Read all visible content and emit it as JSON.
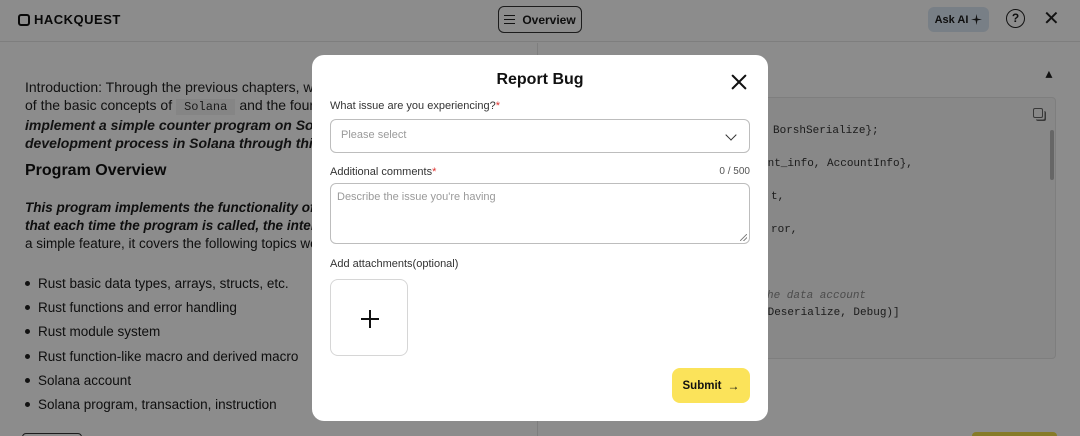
{
  "header": {
    "logo_text": "HACKQUEST",
    "overview_label": "Overview",
    "ask_ai_label": "Ask AI",
    "help_symbol": "?",
    "close_symbol": "✕"
  },
  "lesson": {
    "intro_part1": "Introduction: Through the previous chapters, we ha",
    "intro_part2": "of the basic concepts of",
    "code_term": "Solana",
    "intro_part3": "and the foundat",
    "intro_bold1": "implement a simple counter program on Solana to",
    "intro_bold2": "development process in Solana through this smal",
    "section_title": "Program Overview",
    "overview_bold1": "This program implements the functionality of inc",
    "overview_bold2": "that each time the program is called, the internal",
    "overview_plain": "a simple feature, it covers the following topics we h",
    "topics": [
      "Rust basic data types, arrays, structs, etc.",
      "Rust functions and error handling",
      "Rust module system",
      "Rust function-like macro and derived macro",
      "Solana account",
      "Solana program, transaction, instruction"
    ]
  },
  "code": {
    "lines": [
      "BorshSerialize};",
      "unt_info, AccountInfo},",
      "t,",
      "ror,",
      "he data account",
      "hDeserialize, Debug)]"
    ]
  },
  "modal": {
    "title": "Report Bug",
    "issue_label": "What issue are you experiencing?",
    "required_mark": "*",
    "issue_placeholder": "Please select",
    "comments_label": "Additional comments",
    "comments_counter": "0 / 500",
    "comments_placeholder": "Describe the issue you're having",
    "attachments_label": "Add attachments(optional)",
    "submit_label": "Submit",
    "submit_arrow": "→"
  },
  "colors": {
    "accent_yellow": "#fbe35a",
    "required_red": "#e0322f",
    "ask_ai_bg": "#dbe7f4"
  }
}
